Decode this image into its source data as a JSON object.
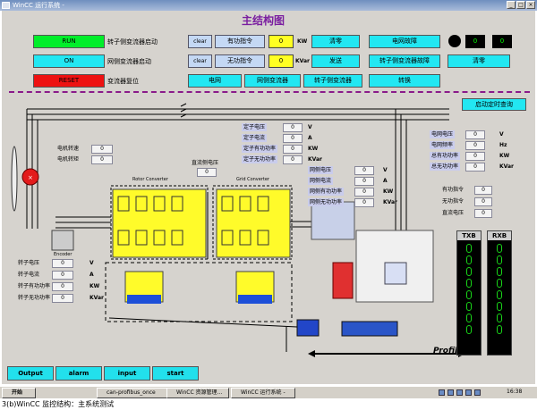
{
  "window": {
    "title": "WinCC 运行系统 -"
  },
  "main_title": "主结构图",
  "controls": {
    "run": "RUN",
    "on": "ON",
    "reset": "RESET",
    "run_desc": "转子侧变流器启动",
    "on_desc": "网侧变流器启动",
    "reset_desc": "变流器复位",
    "clear1": "clear",
    "clear2": "clear",
    "p_cmd": "有功指令",
    "q_cmd": "无功指令",
    "p_val": "0",
    "q_val": "0",
    "p_unit": "KW",
    "q_unit": "KVar",
    "reset_zero": "清零",
    "send": "发送",
    "grid_fault": "电网故障",
    "rotor_conv_fault": "转子侧变流器故障",
    "clear_btn": "清零",
    "disp1": "0",
    "disp2": "0",
    "tab_grid": "电网",
    "tab_grid_conv": "网侧变流器",
    "tab_rotor_conv": "转子侧变流器",
    "tab_switch": "转换"
  },
  "timer_btn": "启动定时查询",
  "motor_labels": {
    "speed": "电机转速",
    "speed_val": "0",
    "accel": "电机转矩",
    "accel_val": "0"
  },
  "stator": {
    "rows": [
      {
        "label": "定子电压",
        "value": "0",
        "unit": "V"
      },
      {
        "label": "定子电流",
        "value": "0",
        "unit": "A"
      },
      {
        "label": "定子有功功率",
        "value": "0",
        "unit": "KW"
      },
      {
        "label": "定子无功功率",
        "value": "0",
        "unit": "KVar"
      }
    ]
  },
  "grid_right": {
    "rows": [
      {
        "label": "电网电压",
        "value": "0",
        "unit": "V"
      },
      {
        "label": "电网频率",
        "value": "0",
        "unit": "Hz"
      },
      {
        "label": "总有功功率",
        "value": "0",
        "unit": "KW"
      },
      {
        "label": "总无功功率",
        "value": "0",
        "unit": "KVar"
      }
    ]
  },
  "gridside": {
    "rows": [
      {
        "label": "网侧电压",
        "value": "0",
        "unit": "V"
      },
      {
        "label": "网侧电流",
        "value": "0",
        "unit": "A"
      },
      {
        "label": "网侧有功功率",
        "value": "0",
        "unit": "KW"
      },
      {
        "label": "网侧无功功率",
        "value": "0",
        "unit": "KVar"
      }
    ]
  },
  "cmd_panel": {
    "rows": [
      {
        "label": "有功指令",
        "value": "0"
      },
      {
        "label": "无功指令",
        "value": "0"
      },
      {
        "label": "直流电压",
        "value": "0"
      }
    ]
  },
  "dc_bus": {
    "label": "直流侧电压",
    "value": "0"
  },
  "rotor": {
    "rows": [
      {
        "label": "转子电压",
        "value": "0",
        "unit": "V"
      },
      {
        "label": "转子电流",
        "value": "0",
        "unit": "A"
      },
      {
        "label": "转子有功功率",
        "value": "0",
        "unit": "KW"
      },
      {
        "label": "转子无功功率",
        "value": "0",
        "unit": "KVar"
      }
    ]
  },
  "diagram": {
    "rotor_conv": "Rotor Converter",
    "grid_conv": "Grid Converter",
    "profibus": "Profibus",
    "encoder": "Encoder"
  },
  "txb": "TXB",
  "rxb": "RXB",
  "bottom": {
    "output": "Output",
    "alarm": "alarm",
    "input": "input",
    "start": "start"
  },
  "taskbar": {
    "start": "开始",
    "items": [
      "can-profibus_once",
      "WinCC 资源管理...",
      "WinCC 运行系统 -"
    ],
    "clock": "16:38"
  },
  "caption": "3(b)WinCC 监控结构：主系统测试"
}
